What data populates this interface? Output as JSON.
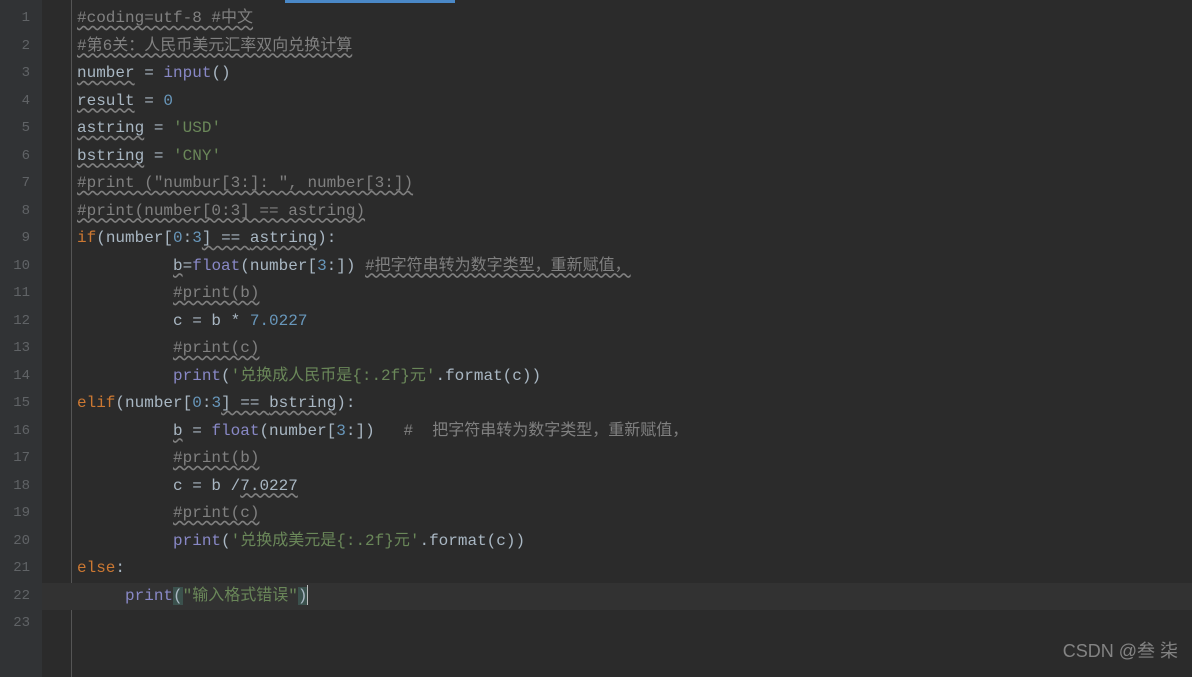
{
  "watermark": "CSDN @叁 柒",
  "lines": {
    "n1": "1",
    "n2": "2",
    "n3": "3",
    "n4": "4",
    "n5": "5",
    "n6": "6",
    "n7": "7",
    "n8": "8",
    "n9": "9",
    "n10": "10",
    "n11": "11",
    "n12": "12",
    "n13": "13",
    "n14": "14",
    "n15": "15",
    "n16": "16",
    "n17": "17",
    "n18": "18",
    "n19": "19",
    "n20": "20",
    "n21": "21",
    "n22": "22",
    "n23": "23"
  },
  "code": {
    "l1_comment": "#coding=utf-8 #中文",
    "l2_comment": "#第6关：人民币美元汇率双向兑换计算",
    "l3_var": "number",
    "l3_eq": " = ",
    "l3_fn": "input",
    "l3_p": "()",
    "l4_var": "result",
    "l4_eq": " = ",
    "l4_val": "0",
    "l5_var": "astring",
    "l5_eq": " = ",
    "l5_val": "'USD'",
    "l6_var": "bstring",
    "l6_eq": " = ",
    "l6_val": "'CNY'",
    "l7_comment": "#print (\"numbur[3:]: \", number[3:])",
    "l8_comment": "#print(number[0:3] == astring)",
    "l9_kw": "if",
    "l9_p1": "(",
    "l9_v1": "number[",
    "l9_n1": "0",
    "l9_c1": ":",
    "l9_n2": "3",
    "l9_v2": "] == ",
    "l9_v3": "astring",
    "l9_p2": ")",
    "l9_c2": ":",
    "l10_v": "b",
    "l10_eq": "=",
    "l10_fn": "float",
    "l10_p1": "(number[",
    "l10_n": "3",
    "l10_p2": ":]) ",
    "l10_comment": "#把字符串转为数字类型，重新赋值，",
    "l11_comment": "#print(b)",
    "l12_v": "c = b * ",
    "l12_n": "7.0227",
    "l13_comment": "#print(c)",
    "l14_fn": "print",
    "l14_p1": "(",
    "l14_s": "'兑换成人民币是{:.2f}元'",
    "l14_m": ".format(c))",
    "l15_kw": "elif",
    "l15_p1": "(",
    "l15_v1": "number[",
    "l15_n1": "0",
    "l15_c1": ":",
    "l15_n2": "3",
    "l15_v2": "] == ",
    "l15_v3": "bstring",
    "l15_p2": ")",
    "l15_c2": ":",
    "l16_v": "b",
    "l16_eq": " = ",
    "l16_fn": "float",
    "l16_p1": "(number[",
    "l16_n": "3",
    "l16_p2": ":])   ",
    "l16_comment": "#  把字符串转为数字类型，重新赋值，",
    "l17_comment": "#print(b)",
    "l18_v": "c = b /",
    "l18_n": "7.0227",
    "l19_comment": "#print(c)",
    "l20_fn": "print",
    "l20_p1": "(",
    "l20_s": "'兑换成美元是{:.2f}元'",
    "l20_m": ".format(c))",
    "l21_kw": "else",
    "l21_c": ":",
    "l22_fn": "print",
    "l22_p1": "(",
    "l22_s": "\"输入格式错误\"",
    "l22_p2": ")"
  }
}
